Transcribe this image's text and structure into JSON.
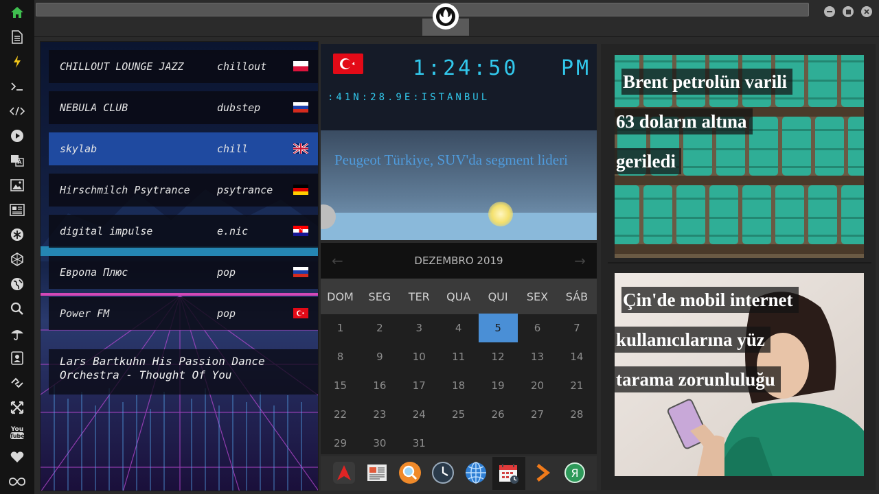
{
  "sidebar": {
    "icons": [
      "home-icon",
      "document-icon",
      "bolt-icon",
      "terminal-icon",
      "code-icon",
      "play-icon",
      "translate-icon",
      "image-icon",
      "news-icon",
      "asterisk-icon",
      "polygon-icon",
      "globe-icon",
      "search-icon",
      "umbrella-icon",
      "contact-icon",
      "link-icon",
      "expand-icon",
      "youtube-icon",
      "heart-icon",
      "infinity-icon"
    ],
    "youtube_label": "You Tube"
  },
  "window": {
    "controls": [
      "minimize-icon",
      "maximize-icon",
      "close-icon"
    ]
  },
  "radio": {
    "stations": [
      {
        "name": "CHILLOUT LOUNGE JAZZ",
        "genre": "chillout",
        "flag": "pl",
        "selected": false
      },
      {
        "name": "NEBULA CLUB",
        "genre": "dubstep",
        "flag": "ru",
        "selected": false
      },
      {
        "name": "skylab",
        "genre": "chill",
        "flag": "gb",
        "selected": true
      },
      {
        "name": "Hirschmilch Psytrance",
        "genre": "psytrance",
        "flag": "de",
        "selected": false
      },
      {
        "name": "digital impulse",
        "genre": "e.nic",
        "flag": "hr",
        "selected": false
      },
      {
        "name": "Европа Плюс",
        "genre": "pop",
        "flag": "ru",
        "selected": false
      },
      {
        "name": "Power FM",
        "genre": "pop",
        "flag": "tr",
        "selected": false
      }
    ],
    "now_playing": "Lars Bartkuhn His Passion Dance Orchestra - Thought Of You"
  },
  "clock": {
    "time": "1:24:50",
    "ampm": "PM",
    "location": ":41N:28.9E:ISTANBUL",
    "flag": "tr",
    "headline": "Peugeot Türkiye, SUV'da segment lideri"
  },
  "calendar": {
    "month_label": "DEZEMBRO 2019",
    "weekdays": [
      "DOM",
      "SEG",
      "TER",
      "QUA",
      "QUI",
      "SEX",
      "SÁB"
    ],
    "first_weekday_index": 0,
    "days_in_month": 31,
    "today": 5
  },
  "dock": {
    "apps": [
      "arch-icon",
      "newspaper-icon",
      "search-app-icon",
      "clock-app-icon",
      "globe-app-icon",
      "calendar-app-icon",
      "play-arrow-icon",
      "yandex-icon"
    ],
    "yandex_letter": "Я",
    "active": 5
  },
  "news": [
    {
      "lines": [
        "Brent petrolün varili",
        "63 doların altına",
        "geriledi"
      ]
    },
    {
      "lines": [
        "Çin'de mobil internet",
        "kullanıcılarına yüz",
        "tarama zorunluluğu"
      ]
    }
  ],
  "colors": {
    "accent_cyan": "#32c8ec",
    "selection_blue": "#1f4aa0",
    "today_blue": "#4a8fd6",
    "headline_blue": "#4f9bdc"
  }
}
